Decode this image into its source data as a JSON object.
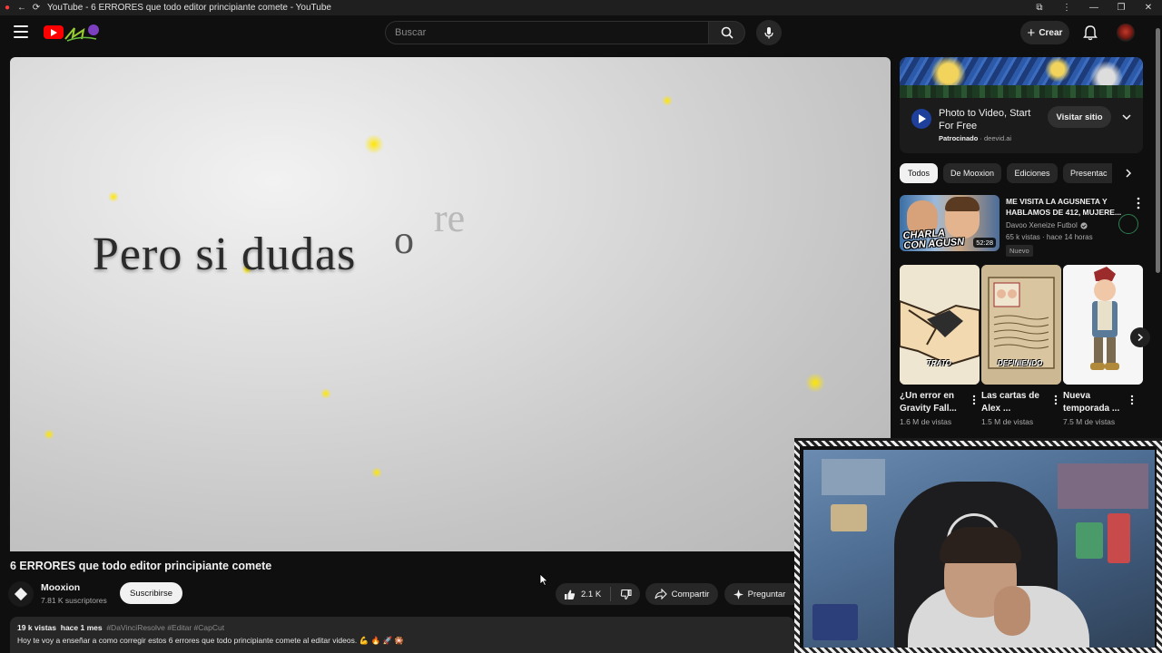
{
  "window": {
    "title": "YouTube - 6 ERRORES que todo editor principiante comete - YouTube"
  },
  "header": {
    "search_placeholder": "Buscar",
    "create_label": "Crear"
  },
  "player": {
    "overlay_text": "Pero si dudas",
    "overlay_text_o": "o",
    "overlay_text_re": "re"
  },
  "video": {
    "title": "6 ERRORES que todo editor principiante comete",
    "channel_name": "Mooxion",
    "channel_subs": "7.81 K suscriptores",
    "subscribe_label": "Suscribirse",
    "likes": "2.1 K",
    "share_label": "Compartir",
    "ask_label": "Preguntar",
    "views": "19 k vistas",
    "age": "hace 1 mes",
    "hashtags": "#DaVinciResolve #Editar #CapCut",
    "description": "Hoy te voy a enseñar a como corregir estos 6 errores que todo principiante comete al editar videos. 💪 🔥 🚀 🎇"
  },
  "ad": {
    "title": "Photo to Video, Start For Free",
    "sponsored_label": "Patrocinado",
    "domain": "deevid.ai",
    "visit_label": "Visitar sitio"
  },
  "chips": [
    {
      "label": "Todos"
    },
    {
      "label": "De Mooxion"
    },
    {
      "label": "Ediciones"
    },
    {
      "label": "Presentac"
    }
  ],
  "related": [
    {
      "title": "ME VISITA LA AGUSNETA Y HABLAMOS DE 412, MUJERE...",
      "thumb_caption_1": "CHARLA",
      "thumb_caption_2": "CON AGUSN",
      "duration": "52:28",
      "channel": "Davoo Xeneize Futbol",
      "views": "65 k vistas · hace 14 horas",
      "badge": "Nuevo"
    }
  ],
  "shorts": [
    {
      "title": "¿Un error en Gravity Fall...",
      "views": "1.6 M de vistas",
      "caption": "TRATO"
    },
    {
      "title": "Las cartas de Alex ...",
      "views": "1.5 M de vistas",
      "caption": "DEFINIENDO"
    },
    {
      "title": "Nueva temporada ...",
      "views": "7.5 M de vistas",
      "caption": ""
    }
  ],
  "colors": {
    "background": "#0f0f0f",
    "surface": "#272727",
    "text": "#f1f1f1",
    "secondary_text": "#aaaaaa",
    "brand_red": "#ff0000",
    "sparkle": "#ffe600"
  }
}
